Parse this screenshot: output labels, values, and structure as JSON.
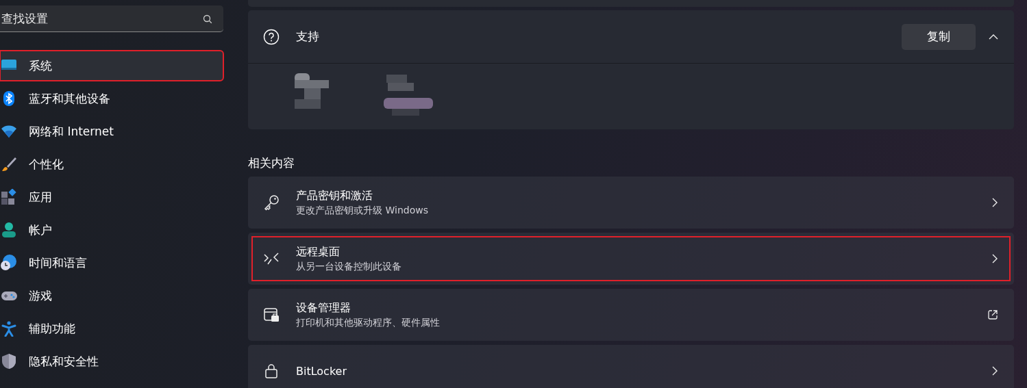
{
  "search": {
    "placeholder": "查找设置"
  },
  "sidebar": {
    "items": [
      {
        "label": "系统",
        "selected": true,
        "highlighted": true
      },
      {
        "label": "蓝牙和其他设备",
        "selected": false,
        "highlighted": false
      },
      {
        "label": "网络和 Internet",
        "selected": false,
        "highlighted": false
      },
      {
        "label": "个性化",
        "selected": false,
        "highlighted": false
      },
      {
        "label": "应用",
        "selected": false,
        "highlighted": false
      },
      {
        "label": "帐户",
        "selected": false,
        "highlighted": false
      },
      {
        "label": "时间和语言",
        "selected": false,
        "highlighted": false
      },
      {
        "label": "游戏",
        "selected": false,
        "highlighted": false
      },
      {
        "label": "辅助功能",
        "selected": false,
        "highlighted": false
      },
      {
        "label": "隐私和安全性",
        "selected": false,
        "highlighted": false
      }
    ]
  },
  "support": {
    "title": "支持",
    "button": "复制",
    "expanded": true,
    "body": {
      "kind": "redacted"
    }
  },
  "related": {
    "heading": "相关内容",
    "rows": [
      {
        "title": "产品密钥和激活",
        "subtitle": "更改产品密钥或升级 Windows",
        "kind": "link",
        "highlighted": false
      },
      {
        "title": "远程桌面",
        "subtitle": "从另一台设备控制此设备",
        "kind": "link",
        "highlighted": true
      },
      {
        "title": "设备管理器",
        "subtitle": "打印机和其他驱动程序、硬件属性",
        "kind": "external",
        "highlighted": false
      },
      {
        "title": "BitLocker",
        "kind": "link",
        "highlighted": false
      }
    ]
  }
}
